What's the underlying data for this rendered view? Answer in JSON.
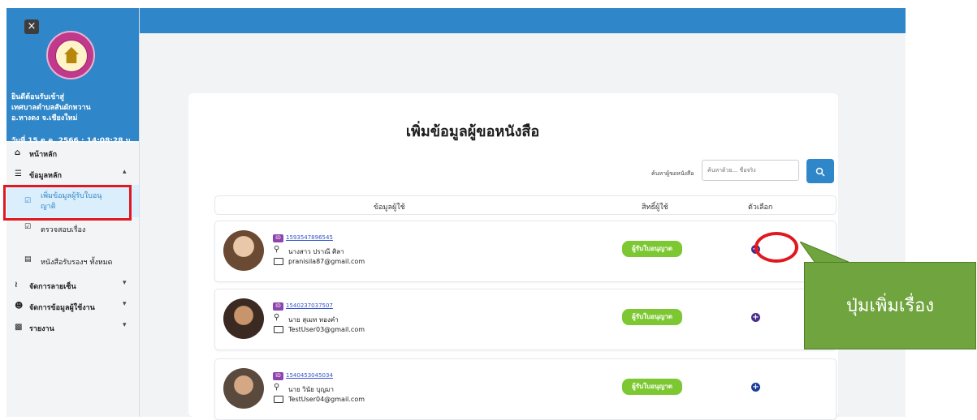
{
  "sidebar": {
    "close_label": "×",
    "welcome_lines": [
      "ยินดีต้อนรับเข้าสู่",
      "เทศบาลตำบลสันผักหวาน",
      "อ.หางดง จ.เชียงใหม่"
    ],
    "datetime": "วันที่ 15 ต.ค. 2566 : 14:08:28 น.",
    "nav": {
      "home": "หน้าหลัก",
      "main_data": "ข้อมูลหลัก",
      "add_applicant_line1": "เพิ่มข้อมูลผู้รับใบอนุ",
      "add_applicant_line2": "ญาติ",
      "check_docs": "ตรวจสอบเรื่อง",
      "all_cert": "หนังสือรับรองฯ ทั้งหมด",
      "signature": "จัดการลายเซ็น",
      "users": "จัดการข้อมูลผู้ใช้งาน",
      "report": "รายงาน"
    }
  },
  "main": {
    "title": "เพิ่มข้อมูลผู้ขอหนังสือ",
    "search": {
      "label": "ค้นหาผู้ขอหนังสือ",
      "placeholder": "ค้นหาด้วย... ชื่อจริง",
      "button_icon": "search-icon"
    },
    "columns": [
      "ข้อมูลผู้ใช้",
      "สิทธิ์ผู้ใช้",
      "ตัวเลือก"
    ],
    "rows": [
      {
        "id": "1593547896545",
        "name": "นางสาว ปราณี ศิลา",
        "email": "pranisila87@gmail.com",
        "permission": "ผู้รับใบอนุญาต",
        "plus_color": "#4a2c8a"
      },
      {
        "id": "1540237037507",
        "name": "นาย สุเมท ทองคำ",
        "email": "TestUser03@gmail.com",
        "permission": "ผู้รับใบอนุญาต",
        "plus_color": "#4a2c8a"
      },
      {
        "id": "1540453045034",
        "name": "นาย วินัย บุญมา",
        "email": "TestUser04@gmail.com",
        "permission": "ผู้รับใบอนุญาต",
        "plus_color": "#1a3c9a"
      }
    ]
  },
  "annotation": {
    "callout_text": "ปุ่มเพิ่มเรื่อง"
  },
  "colors": {
    "header_blue": "#2f86c8",
    "permission_green": "#7dc832",
    "annotation_red": "#e0181f",
    "callout_green": "#6fa43e"
  }
}
